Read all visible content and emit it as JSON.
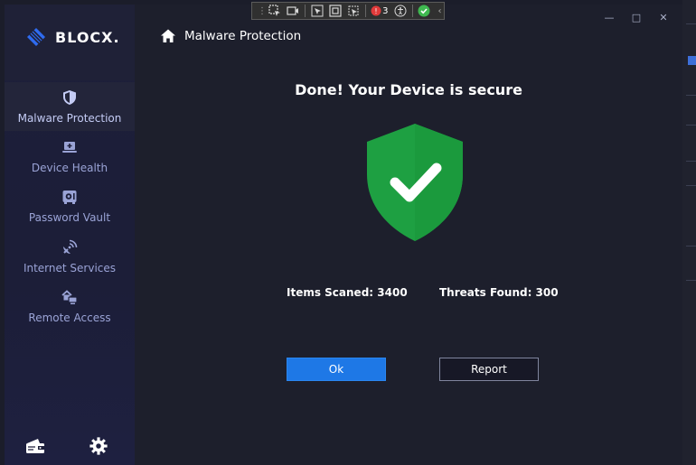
{
  "app": {
    "brand": "BLOCX.",
    "header_title": "Malware Protection"
  },
  "sidebar": {
    "items": [
      {
        "label": "Malware Protection",
        "icon": "shield-icon",
        "active": true
      },
      {
        "label": "Device Health",
        "icon": "laptop-plus-icon",
        "active": false
      },
      {
        "label": "Password Vault",
        "icon": "vault-icon",
        "active": false
      },
      {
        "label": "Internet Services",
        "icon": "satellite-icon",
        "active": false
      },
      {
        "label": "Remote Access",
        "icon": "remote-access-icon",
        "active": false
      }
    ],
    "bottom_icons": [
      "wallet-icon",
      "gear-icon"
    ]
  },
  "main": {
    "title": "Done! Your Device is secure",
    "items_scanned": "Items Scaned: 3400",
    "threats_found": "Threats Found: 300",
    "ok_label": "Ok",
    "report_label": "Report"
  },
  "debug_toolbar": {
    "badge_count": "3"
  },
  "colors": {
    "accent_blue": "#1e78e6",
    "shield_green": "#1ea042",
    "sidebar_text": "#9aa3d6",
    "background": "#1d1f2c"
  }
}
